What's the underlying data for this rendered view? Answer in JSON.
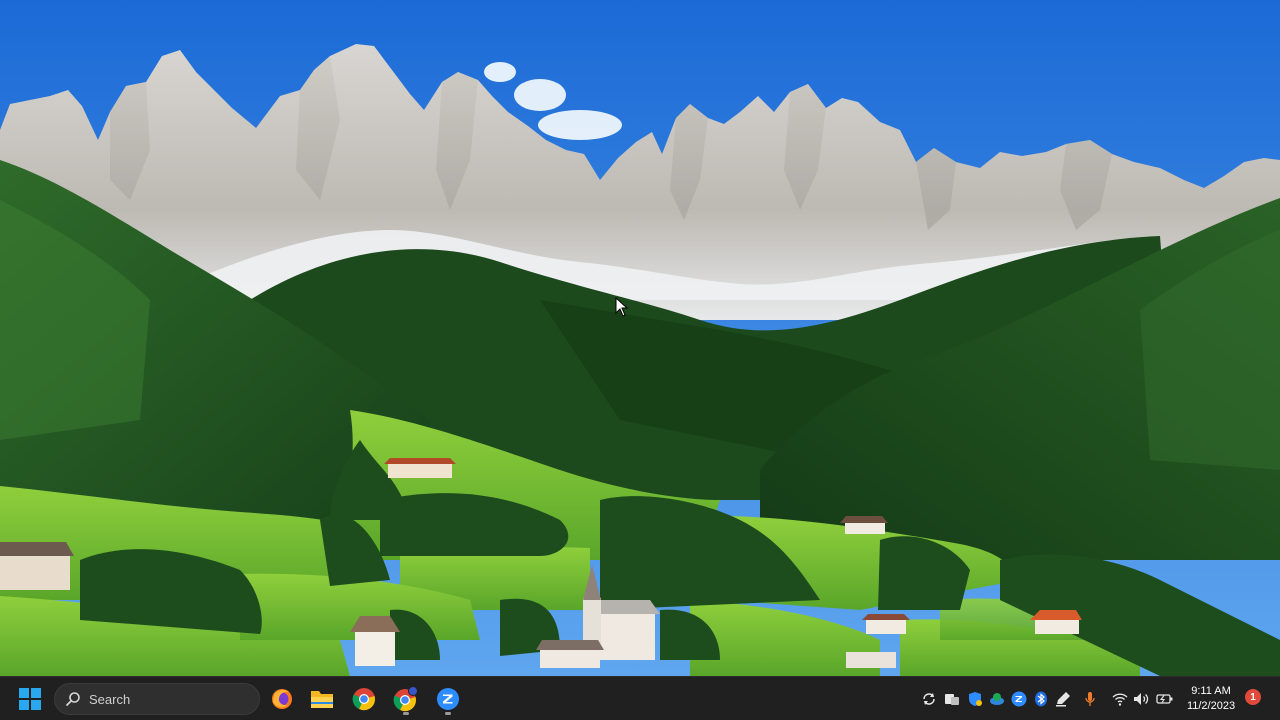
{
  "taskbar": {
    "search_label": "Search",
    "pinned_apps": [
      {
        "name": "firefox-icon"
      },
      {
        "name": "file-explorer-icon"
      },
      {
        "name": "chrome-icon"
      },
      {
        "name": "chrome-profile-icon"
      },
      {
        "name": "zoom-icon"
      }
    ]
  },
  "tray": {
    "icons": [
      "sync-icon",
      "copilot-icon",
      "defender-icon",
      "onedrive-icon",
      "zoom-tray-icon",
      "bluetooth-icon",
      "edit-icon",
      "microphone-icon",
      "wifi-icon",
      "volume-icon",
      "battery-icon"
    ],
    "time": "9:11 AM",
    "date": "11/2/2023",
    "notification_count": "1"
  },
  "colors": {
    "sky_top": "#1b6ad6",
    "sky_bottom": "#5fa6ef",
    "taskbar": "#202020",
    "badge": "#e04a3a"
  }
}
